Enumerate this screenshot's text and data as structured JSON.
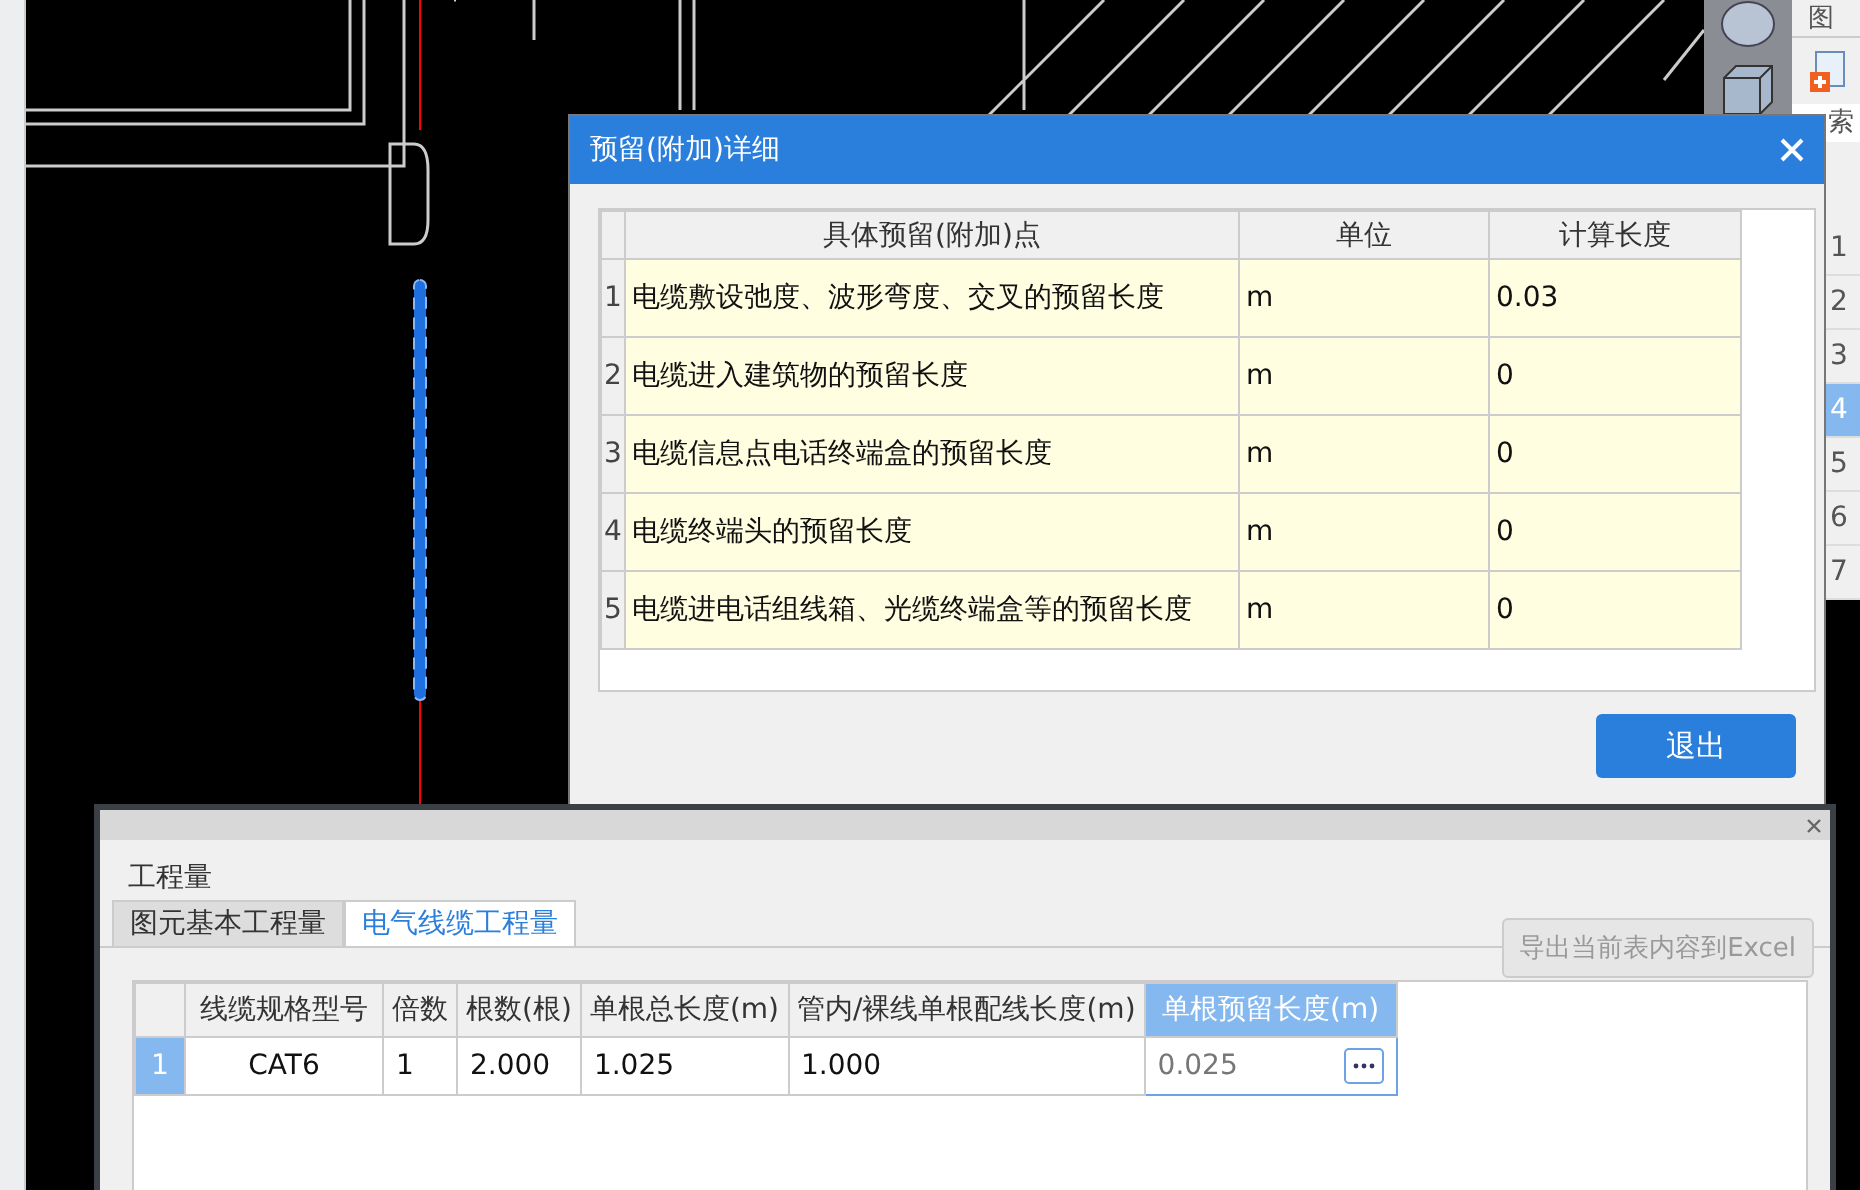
{
  "side_panel": {
    "tab_label": "图",
    "search_placeholder": "索",
    "rows": [
      {
        "number": "1",
        "selected": false
      },
      {
        "number": "2",
        "selected": false
      },
      {
        "number": "3",
        "selected": false
      },
      {
        "number": "4",
        "selected": true
      },
      {
        "number": "5",
        "selected": false
      },
      {
        "number": "6",
        "selected": false
      },
      {
        "number": "7",
        "selected": false
      }
    ]
  },
  "dialog": {
    "title": "预留(附加)详细",
    "columns": [
      "具体预留(附加)点",
      "单位",
      "计算长度"
    ],
    "rows": [
      {
        "number": "1",
        "point": "电缆敷设弛度、波形弯度、交叉的预留长度",
        "unit": "m",
        "length": "0.03"
      },
      {
        "number": "2",
        "point": "电缆进入建筑物的预留长度",
        "unit": "m",
        "length": "0"
      },
      {
        "number": "3",
        "point": "电缆信息点电话终端盒的预留长度",
        "unit": "m",
        "length": "0"
      },
      {
        "number": "4",
        "point": "电缆终端头的预留长度",
        "unit": "m",
        "length": "0"
      },
      {
        "number": "5",
        "point": "电缆进电话组线箱、光缆终端盒等的预留长度",
        "unit": "m",
        "length": "0"
      }
    ],
    "exit_button": "退出"
  },
  "quantity_panel": {
    "title": "工程量",
    "tabs": [
      {
        "label": "图元基本工程量",
        "selected": false
      },
      {
        "label": "电气线缆工程量",
        "selected": true
      }
    ],
    "export_button": {
      "label": "导出当前表内容到Excel",
      "disabled": true
    },
    "columns": [
      {
        "label": "线缆规格型号",
        "selected": false
      },
      {
        "label": "倍数",
        "selected": false
      },
      {
        "label": "根数(根)",
        "selected": false
      },
      {
        "label": "单根总长度(m)",
        "selected": false
      },
      {
        "label": "管内/裸线单根配线长度(m)",
        "selected": false
      },
      {
        "label": "单根预留长度(m)",
        "selected": true
      }
    ],
    "rows": [
      {
        "number": "1",
        "selected": true,
        "cells": [
          "CAT6",
          "1",
          "2.000",
          "1.025",
          "1.000",
          "0.025"
        ]
      }
    ]
  }
}
